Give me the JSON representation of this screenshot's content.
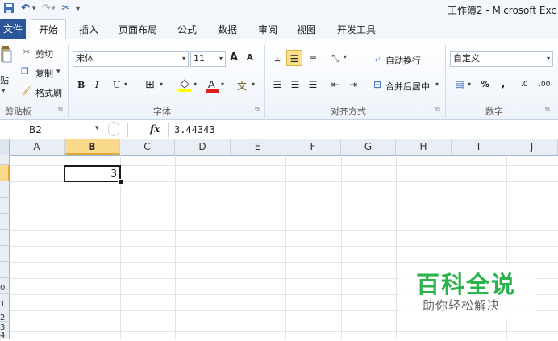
{
  "window": {
    "title": "工作簿2 - Microsoft Exc"
  },
  "qat": {
    "save_icon": "save-icon",
    "undo_icon": "undo-icon",
    "redo_icon": "redo-icon",
    "customize": "▾"
  },
  "tabs": {
    "file": "文件",
    "home": "开始",
    "insert": "插入",
    "page_layout": "页面布局",
    "formulas": "公式",
    "data": "数据",
    "review": "审阅",
    "view": "视图",
    "developer": "开发工具"
  },
  "ribbon": {
    "clipboard": {
      "paste": "贴",
      "cut": "剪切",
      "copy": "复制",
      "format_painter": "格式刷",
      "label": "剪贴板"
    },
    "font": {
      "name": "宋体",
      "size": "11",
      "grow": "A",
      "shrink": "A",
      "bold": "B",
      "italic": "I",
      "underline": "U",
      "label": "字体",
      "wen": "文"
    },
    "alignment": {
      "wrap": "自动换行",
      "merge": "合并后居中",
      "label": "对齐方式"
    },
    "number": {
      "format": "自定义",
      "percent": "%",
      "comma": ",",
      "inc_dec": ".0",
      "dec_dec": ".00",
      "label": "数字"
    }
  },
  "formula_bar": {
    "name_box": "B2",
    "fx": "fx",
    "formula": "3.44343"
  },
  "grid": {
    "columns": [
      "A",
      "B",
      "C",
      "D",
      "E",
      "F",
      "G",
      "H",
      "I",
      "J"
    ],
    "row_headers": [
      "",
      "",
      "",
      "",
      "",
      "",
      "",
      "",
      "0",
      "1",
      "2",
      "3",
      "4"
    ],
    "active_cell_value": "3"
  },
  "watermark": {
    "title": "百科全说",
    "subtitle": "助你轻松解决",
    "title_color": "#2bb24c"
  }
}
